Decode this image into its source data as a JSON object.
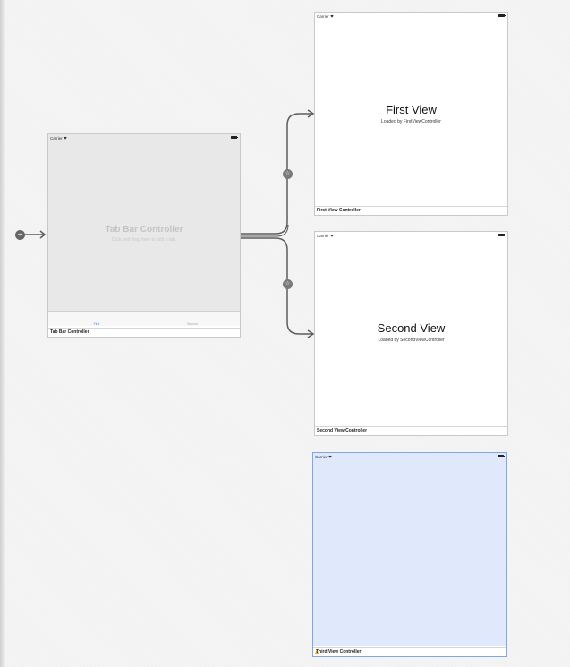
{
  "common": {
    "carrier": "Carrier"
  },
  "tab_bar_controller": {
    "title": "Tab Bar Controller",
    "hint": "Click and drag here to add a tab.",
    "tabs": [
      {
        "label": "First"
      },
      {
        "label": "Second"
      }
    ],
    "scene_label": "Tab Bar Controller"
  },
  "first_view": {
    "title": "First View",
    "subtitle": "Loaded by FirstViewController",
    "scene_label": "First View Controller"
  },
  "second_view": {
    "title": "Second View",
    "subtitle": "Loaded by SecondViewController",
    "scene_label": "Second View Controller"
  },
  "third_view": {
    "scene_label": "Third View Controller"
  },
  "icons": {
    "entry_point": "arrow-right-icon",
    "segue_badge": "star-icon",
    "warning": "warning-icon",
    "wifi": "wifi-icon",
    "battery": "battery-icon"
  },
  "colors": {
    "canvas": "#f4f4f4",
    "selected_scene": "#dfe9fb",
    "selected_border": "#7fa7e6",
    "tab_selected": "#4a8ef0",
    "connector": "#5c5c5c"
  }
}
